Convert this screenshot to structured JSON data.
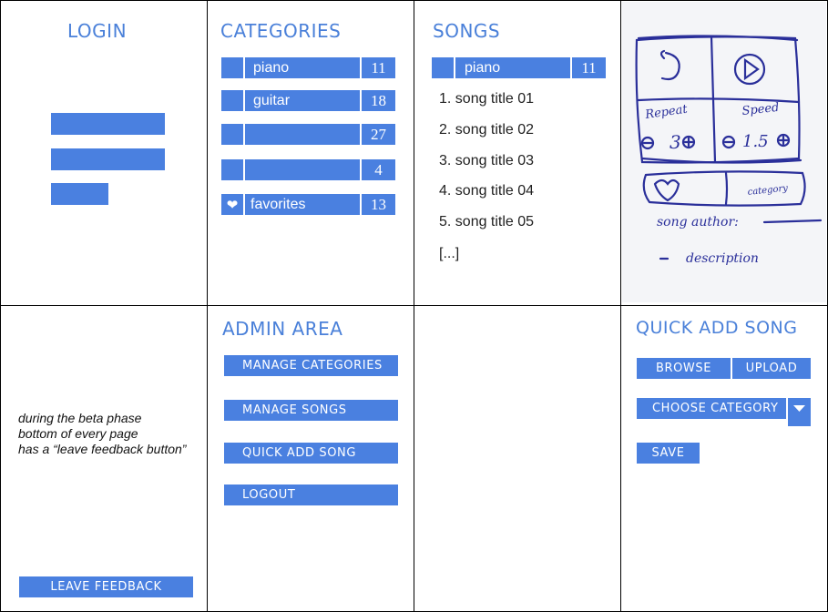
{
  "login": {
    "title": "LOGIN"
  },
  "categories": {
    "title": "CATEGORIES",
    "items": [
      {
        "label": "piano",
        "count": "11",
        "icon": ""
      },
      {
        "label": "guitar",
        "count": "18",
        "icon": ""
      },
      {
        "label": "",
        "count": "27",
        "icon": ""
      },
      {
        "label": "",
        "count": "4",
        "icon": ""
      },
      {
        "label": "favorites",
        "count": "13",
        "icon": "heart-icon"
      }
    ]
  },
  "songs": {
    "title": "SONGS",
    "selected": {
      "label": "piano",
      "count": "11"
    },
    "list": [
      "1. song title 01",
      "2. song title 02",
      "3. song title 03",
      "4. song title 04",
      "5. song title 05"
    ],
    "more": "[...]"
  },
  "sketch": {
    "repeat_label": "Repeat",
    "repeat_value": "3",
    "speed_label": "Speed",
    "speed_value": "1.5",
    "category_label": "category",
    "author_label": "song author:",
    "description_label": "description"
  },
  "feedback": {
    "note": [
      "during the beta phase",
      "bottom of every page",
      "has a “leave feedback button”"
    ],
    "button": "LEAVE FEEDBACK"
  },
  "admin": {
    "title": "ADMIN AREA",
    "buttons": [
      "MANAGE CATEGORIES",
      "MANAGE SONGS",
      "QUICK ADD SONG",
      "LOGOUT"
    ]
  },
  "quick_add": {
    "title": "QUICK ADD SONG",
    "browse": "BROWSE",
    "upload": "UPLOAD",
    "choose_category": "CHOOSE CATEGORY",
    "save": "SAVE"
  },
  "colors": {
    "accent": "#4a80e0",
    "heading": "#4a80d9",
    "sketch_ink": "#2a2f9a"
  }
}
